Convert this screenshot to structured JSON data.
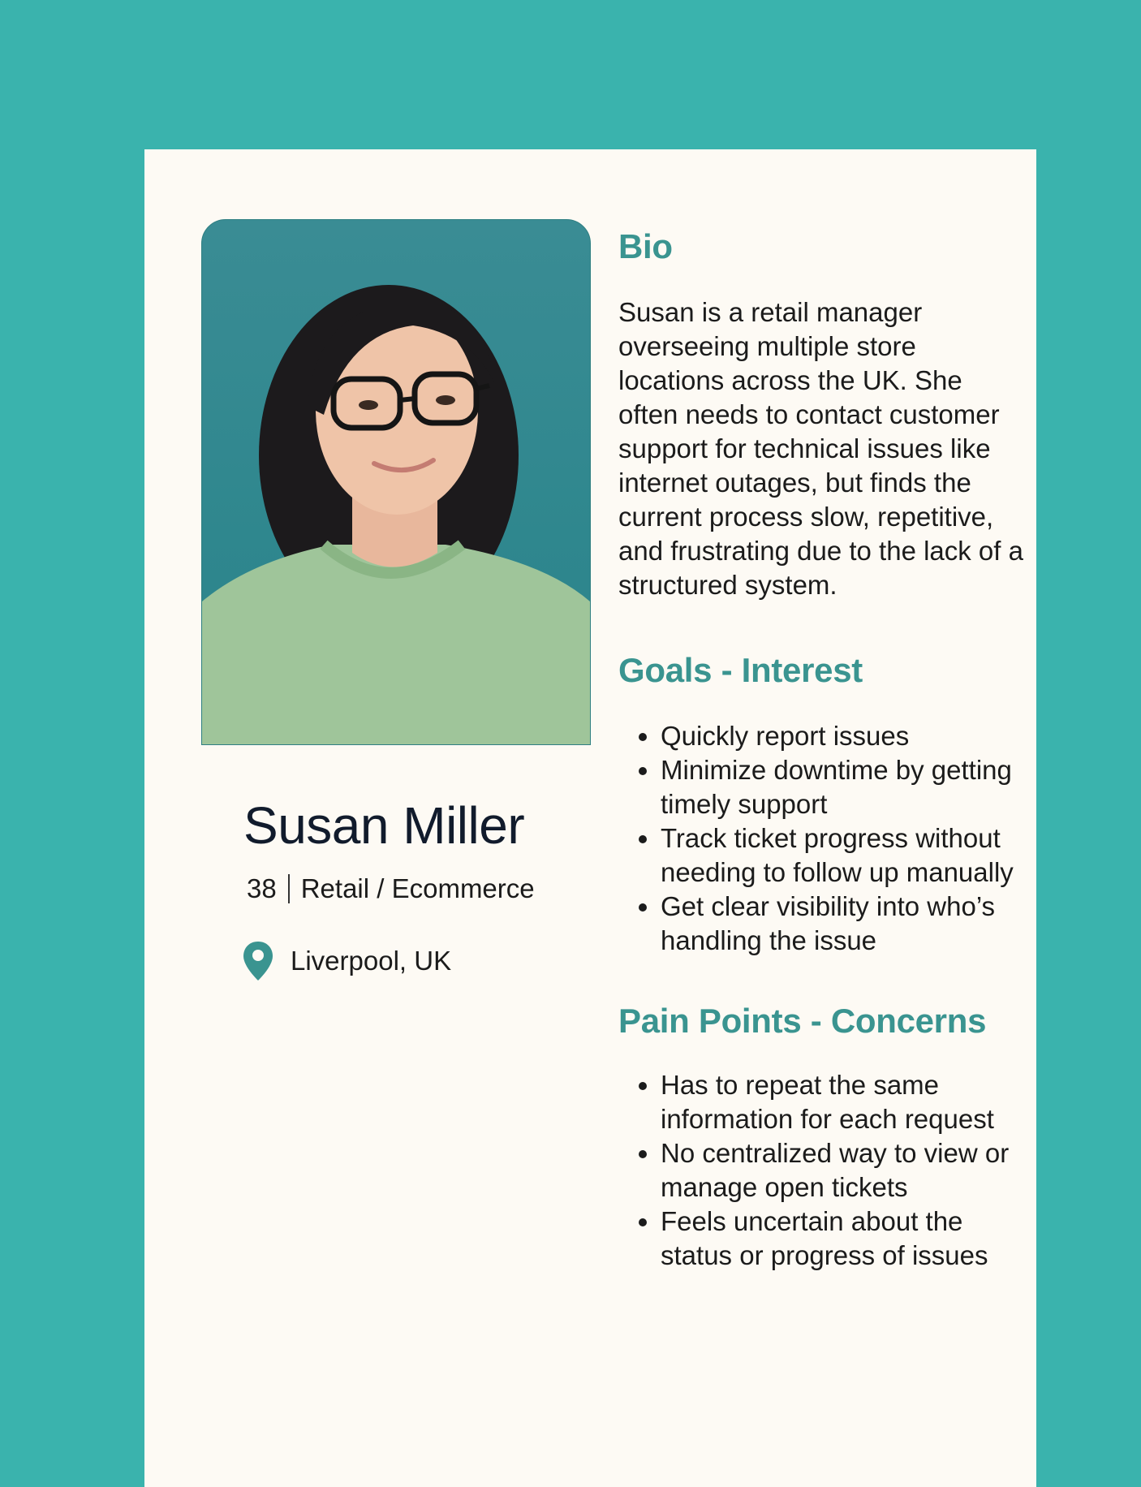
{
  "profile": {
    "name": "Susan Miller",
    "age": "38",
    "industry": "Retail / Ecommerce",
    "location": "Liverpool, UK"
  },
  "bio": {
    "heading": "Bio",
    "text": "Susan is a retail manager overseeing multiple store locations across the UK. She often needs to contact customer support for technical issues like internet outages, but finds the current process slow, repetitive, and frustrating due to the lack of a structured system."
  },
  "goals": {
    "heading": "Goals - Interest",
    "items": [
      "Quickly report issues",
      "Minimize downtime by getting timely support",
      "Track ticket progress without needing to follow up manually",
      "Get clear visibility into who’s handling the issue"
    ]
  },
  "pain_points": {
    "heading": "Pain Points - Concerns",
    "items": [
      "Has to repeat the same information for each request",
      "No centralized way to view or manage open tickets",
      "Feels uncertain about the status or progress of issues"
    ]
  },
  "colors": {
    "background": "#3ab3ad",
    "card": "#fdfaf4",
    "heading": "#3a9490",
    "pin": "#3a9490"
  },
  "icons": {
    "location": "location-pin-icon"
  }
}
